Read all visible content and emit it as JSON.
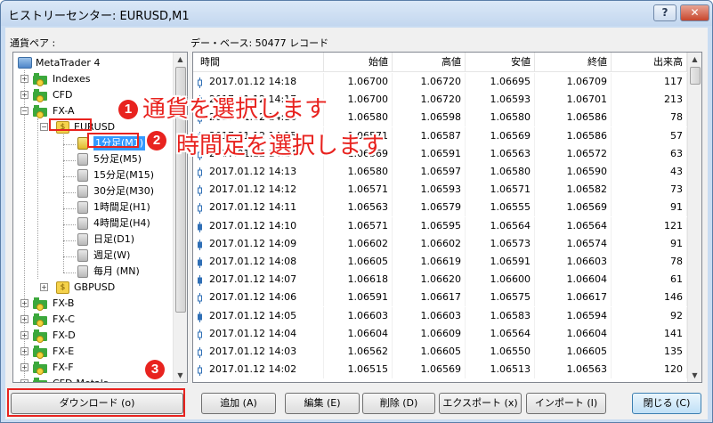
{
  "window": {
    "title": "ヒストリーセンター: EURUSD,M1",
    "help_label": "?",
    "close_label": "✕"
  },
  "labels": {
    "pair_label": "通貨ペア :",
    "db_label": "デー・ベース: 50477 レコード"
  },
  "tree": {
    "root": "MetaTrader 4",
    "groups_top": [
      "Indexes",
      "CFD",
      "FX-A"
    ],
    "symbol": "EURUSD",
    "timeframes": [
      "1分足(M1)",
      "5分足(M5)",
      "15分足(M15)",
      "30分足(M30)",
      "1時間足(H1)",
      "4時間足(H4)",
      "日足(D1)",
      "週足(W)",
      "毎月 (MN)"
    ],
    "symbol2": "GBPUSD",
    "groups_bottom": [
      "FX-B",
      "FX-C",
      "FX-D",
      "FX-E",
      "FX-F",
      "CFD-Metals"
    ]
  },
  "grid": {
    "columns": [
      "時間",
      "始値",
      "高値",
      "安値",
      "終値",
      "出来高"
    ],
    "rows": [
      [
        "2017.01.12 14:18",
        "1.06700",
        "1.06720",
        "1.06695",
        "1.06709",
        "117"
      ],
      [
        "2017.01.12 14:17",
        "1.06700",
        "1.06720",
        "1.06593",
        "1.06701",
        "213"
      ],
      [
        "2017.01.12 14:16",
        "1.06580",
        "1.06598",
        "1.06580",
        "1.06586",
        "78"
      ],
      [
        "2017.01.12 14:15",
        "1.06571",
        "1.06587",
        "1.06569",
        "1.06586",
        "57"
      ],
      [
        "2017.01.12 14:14",
        "1.06569",
        "1.06591",
        "1.06563",
        "1.06572",
        "63"
      ],
      [
        "2017.01.12 14:13",
        "1.06580",
        "1.06597",
        "1.06580",
        "1.06590",
        "43"
      ],
      [
        "2017.01.12 14:12",
        "1.06571",
        "1.06593",
        "1.06571",
        "1.06582",
        "73"
      ],
      [
        "2017.01.12 14:11",
        "1.06563",
        "1.06579",
        "1.06555",
        "1.06569",
        "91"
      ],
      [
        "2017.01.12 14:10",
        "1.06571",
        "1.06595",
        "1.06564",
        "1.06564",
        "121"
      ],
      [
        "2017.01.12 14:09",
        "1.06602",
        "1.06602",
        "1.06573",
        "1.06574",
        "91"
      ],
      [
        "2017.01.12 14:08",
        "1.06605",
        "1.06619",
        "1.06591",
        "1.06603",
        "78"
      ],
      [
        "2017.01.12 14:07",
        "1.06618",
        "1.06620",
        "1.06600",
        "1.06604",
        "61"
      ],
      [
        "2017.01.12 14:06",
        "1.06591",
        "1.06617",
        "1.06575",
        "1.06617",
        "146"
      ],
      [
        "2017.01.12 14:05",
        "1.06603",
        "1.06603",
        "1.06583",
        "1.06594",
        "92"
      ],
      [
        "2017.01.12 14:04",
        "1.06604",
        "1.06609",
        "1.06564",
        "1.06604",
        "141"
      ],
      [
        "2017.01.12 14:03",
        "1.06562",
        "1.06605",
        "1.06550",
        "1.06605",
        "135"
      ],
      [
        "2017.01.12 14:02",
        "1.06515",
        "1.06569",
        "1.06513",
        "1.06563",
        "120"
      ]
    ]
  },
  "buttons": {
    "download": "ダウンロード (o)",
    "add": "追加 (A)",
    "edit": "編集 (E)",
    "delete": "削除 (D)",
    "export": "エクスポート (x)",
    "import": "インポート (I)",
    "close": "閉じる (C)"
  },
  "annotations": {
    "n1": "1",
    "text1": "通貨を選択します",
    "n2": "2",
    "text2": "時間足を選択します",
    "n3": "3"
  },
  "colors": {
    "accent_red": "#e8231f",
    "folder_green": "#3ca83c",
    "candle_blue": "#2f6fb6"
  }
}
